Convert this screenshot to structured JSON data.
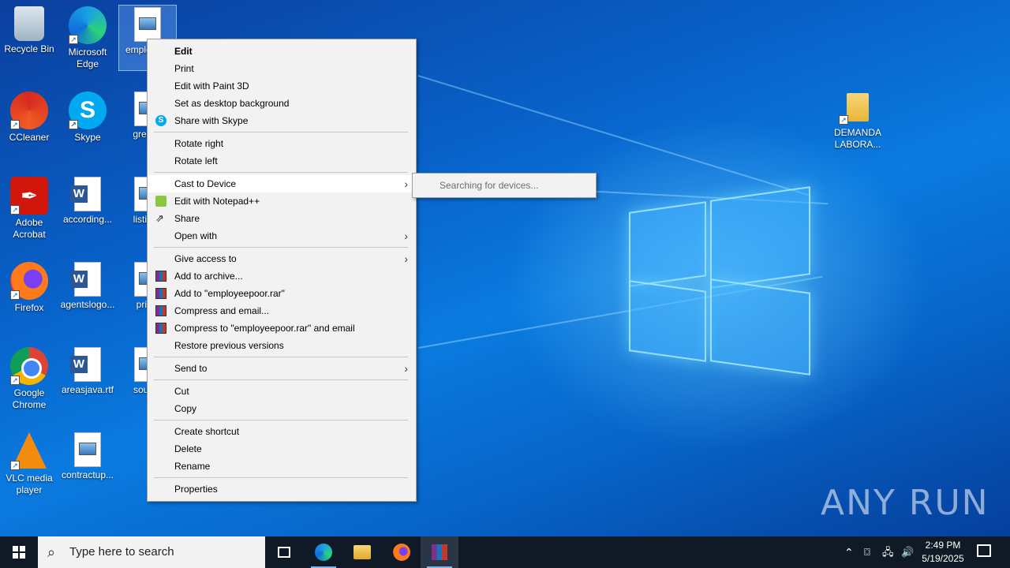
{
  "desktop": {
    "icons": [
      {
        "label": "Recycle Bin",
        "icon": "recycle-bin-icon"
      },
      {
        "label": "Microsoft Edge",
        "icon": "edge-icon"
      },
      {
        "label": "emplo or.p",
        "icon": "image-file-icon"
      },
      {
        "label": "CCleaner",
        "icon": "ccleaner-icon"
      },
      {
        "label": "Skype",
        "icon": "skype-icon"
      },
      {
        "label": "greenp",
        "icon": "image-file-icon"
      },
      {
        "label": "Adobe Acrobat",
        "icon": "acrobat-icon"
      },
      {
        "label": "according...",
        "icon": "word-doc-icon"
      },
      {
        "label": "listings",
        "icon": "image-file-icon"
      },
      {
        "label": "Firefox",
        "icon": "firefox-icon"
      },
      {
        "label": "agentslogo...",
        "icon": "word-doc-icon"
      },
      {
        "label": "pricin",
        "icon": "image-file-icon"
      },
      {
        "label": "Google Chrome",
        "icon": "chrome-icon"
      },
      {
        "label": "areasjava.rtf",
        "icon": "word-doc-icon"
      },
      {
        "label": "southe",
        "icon": "image-file-icon"
      },
      {
        "label": "VLC media player",
        "icon": "vlc-icon"
      },
      {
        "label": "contractup...",
        "icon": "image-file-icon"
      },
      {
        "label": "DEMANDA LABORA...",
        "icon": "folder-icon"
      }
    ]
  },
  "context_menu": {
    "items": [
      {
        "label": "Edit"
      },
      {
        "label": "Print"
      },
      {
        "label": "Edit with Paint 3D"
      },
      {
        "label": "Set as desktop background"
      },
      {
        "label": "Share with Skype"
      },
      {
        "label": "Rotate right"
      },
      {
        "label": "Rotate left"
      },
      {
        "label": "Cast to Device"
      },
      {
        "label": "Edit with Notepad++"
      },
      {
        "label": "Share"
      },
      {
        "label": "Open with"
      },
      {
        "label": "Give access to"
      },
      {
        "label": "Add to archive..."
      },
      {
        "label": "Add to \"employeepoor.rar\""
      },
      {
        "label": "Compress and email..."
      },
      {
        "label": "Compress to \"employeepoor.rar\" and email"
      },
      {
        "label": "Restore previous versions"
      },
      {
        "label": "Send to"
      },
      {
        "label": "Cut"
      },
      {
        "label": "Copy"
      },
      {
        "label": "Create shortcut"
      },
      {
        "label": "Delete"
      },
      {
        "label": "Rename"
      },
      {
        "label": "Properties"
      }
    ],
    "submenu": {
      "label": "Searching for devices..."
    }
  },
  "watermark": "ANY RUN",
  "taskbar": {
    "search_placeholder": "Type here to search",
    "apps": [
      "task-view-icon",
      "edge-icon",
      "file-explorer-icon",
      "firefox-icon",
      "winrar-icon"
    ],
    "clock": {
      "time": "2:49 PM",
      "date": "5/19/2025"
    }
  }
}
